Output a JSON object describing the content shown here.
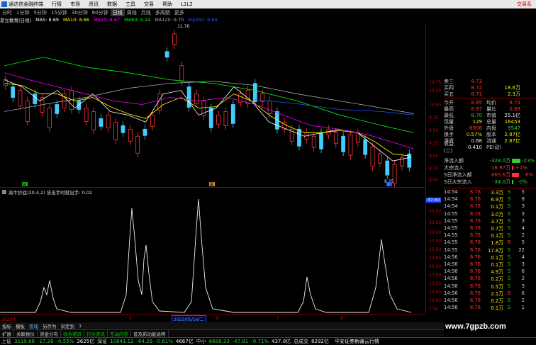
{
  "titlebar": {
    "app_name": "通达信金融终端",
    "menus": [
      "行情",
      "市场",
      "资讯",
      "数据",
      "工具",
      "交易",
      "帮助",
      "L1L2"
    ],
    "right_label": "交易系"
  },
  "toolbar": {
    "items": [
      "分时",
      "1分钟",
      "5分钟",
      "15分钟",
      "30分钟",
      "60分钟",
      "日线",
      "周线",
      "月线",
      "多周期",
      "更多"
    ],
    "active": "日线"
  },
  "ma_legend": {
    "stock": "昂立教育(日线)",
    "ma5": "MA5: 8.69",
    "ma10": "MA10: 8.66",
    "ma20": "MA20: 8.67",
    "ma60": "MA60: 9.24",
    "ma120": "MA120: 9.70",
    "ma250": "MA250: 9.89",
    "colors": {
      "ma5": "#ffffff",
      "ma10": "#ffff00",
      "ma20": "#ff00ff",
      "ma60": "#00ff00",
      "ma120": "#aaaaaa",
      "ma250": "#2255ff"
    }
  },
  "price_axis": [
    "11.25",
    "11.00",
    "10.75",
    "10.50",
    "10.25",
    "10.00",
    "9.75",
    "9.50",
    "9.25",
    "9.00",
    "8.75",
    "8.50",
    "8.25"
  ],
  "annotations": {
    "high": "11.76",
    "low": "8.25",
    "marker_left": "减",
    "marker_mid": "赢",
    "marker_low": "I"
  },
  "indicator": {
    "legend": "高牛抄底(20,4,2)  该出手时就出手: 0.02",
    "axis": [
      "37.50",
      "35.00",
      "32.50",
      "30.00",
      "27.50",
      "25.00",
      "22.50",
      "20.00",
      "17.50",
      "15.00",
      "12.50",
      "10.00",
      "7.50",
      "5.00",
      "2.50"
    ]
  },
  "dates": {
    "year": "2023年",
    "cursor_date": "2023/05/16/二",
    "months": [
      "5",
      "6",
      "7",
      "8"
    ]
  },
  "tabbar": [
    "指标",
    "模板",
    "管理",
    "另存为",
    "训定到",
    "1"
  ],
  "tabbar2": [
    "扩展",
    "关联报价",
    "资金分布",
    "综合资讯",
    "行业资讯",
    "互动问答",
    "普及新功能说明"
  ],
  "quote": {
    "asks": [
      {
        "label": "卖三",
        "price": "8.73",
        "vol": ""
      },
      {
        "label": "买四",
        "price": "8.72",
        "vol": "18.6万"
      },
      {
        "label": "买五",
        "price": "8.71",
        "vol": "2.3万"
      }
    ],
    "rows": [
      {
        "l1": "今开",
        "v1": "8.85",
        "l2": "均价",
        "v2": "8.73"
      },
      {
        "l1": "最高",
        "v1": "8.87",
        "l2": "量比",
        "v2": "0.69"
      },
      {
        "l1": "最低",
        "v1": "8.70",
        "l2": "市值",
        "v2": "25.1亿"
      },
      {
        "l1": "现量",
        "v1": "129",
        "l2": "总量",
        "v2": "16453"
      },
      {
        "l1": "外盘",
        "v1": "6906",
        "l2": "内盘",
        "v2": "9547"
      },
      {
        "l1": "换手",
        "v1": "0.57%",
        "l2": "股本",
        "v2": "2.87亿"
      },
      {
        "l1": "净资",
        "v1": "0.68",
        "l2": "流通",
        "v2": "2.87亿"
      },
      {
        "l1": "收益(二)",
        "v1": "-0.410",
        "l2": "PE(动)",
        "v2": ""
      }
    ]
  },
  "flow": [
    {
      "label": "净流入额",
      "value": "-328.0万",
      "pct": "-23%",
      "color": "#3c3"
    },
    {
      "label": "大宗流入",
      "value": "16.97万",
      "pct": "+1%",
      "color": "#f33"
    },
    {
      "label": "5日净流入额",
      "value": "665.6万",
      "pct": "6%",
      "color": "#f33"
    },
    {
      "label": "5日大宗流入",
      "value": "-34.0万",
      "pct": "-0%",
      "color": "#3c3"
    }
  ],
  "ticks": [
    {
      "t": "14:54",
      "p": "8.76",
      "v": "3.3万",
      "s": "S",
      "n": "5"
    },
    {
      "t": "14:54",
      "p": "8.76",
      "v": "6.9万",
      "s": "S",
      "n": "8"
    },
    {
      "t": "14:54",
      "p": "8.76",
      "v": "0.1万",
      "s": "S",
      "n": "3"
    },
    {
      "t": "14:55",
      "p": "8.76",
      "v": "3.0万",
      "s": "S",
      "n": "3"
    },
    {
      "t": "14:55",
      "p": "8.76",
      "v": "3.7万",
      "s": "S",
      "n": "3"
    },
    {
      "t": "14:55",
      "p": "8.76",
      "v": "0.7万",
      "s": "S",
      "n": "4"
    },
    {
      "t": "14:55",
      "p": "8.76",
      "v": "0.1万",
      "s": "S",
      "n": "2"
    },
    {
      "t": "14:55",
      "p": "8.76",
      "v": "1.8万",
      "s": "B",
      "n": "5"
    },
    {
      "t": "14:55",
      "p": "8.76",
      "v": "17.8万",
      "s": "S",
      "n": "22"
    },
    {
      "t": "14:56",
      "p": "8.76",
      "v": "0.1万",
      "s": "S",
      "n": "4"
    },
    {
      "t": "14:56",
      "p": "8.76",
      "v": "0.1万",
      "s": "S",
      "n": "3"
    },
    {
      "t": "14:56",
      "p": "8.76",
      "v": "4.9万",
      "s": "S",
      "n": "6"
    },
    {
      "t": "14:56",
      "p": "8.76",
      "v": "0.2万",
      "s": "S",
      "n": "2"
    },
    {
      "t": "14:56",
      "p": "8.76",
      "v": "0.5万",
      "s": "S",
      "n": "3"
    },
    {
      "t": "14:56",
      "p": "8.76",
      "v": "2.1万",
      "s": "B",
      "n": "6"
    },
    {
      "t": "14:56",
      "p": "8.76",
      "v": "0.2万",
      "s": "S",
      "n": "2"
    },
    {
      "t": "14:56",
      "p": "8.76",
      "v": "0.1万",
      "s": "S",
      "n": "1"
    }
  ],
  "statusbar": {
    "sh_name": "上证",
    "sh_val": "3119.88",
    "sh_chg": "-17.26",
    "sh_pct": "-0.55%",
    "sh_amt": "3625亿",
    "sz_name": "深证",
    "sz_val": "10841.12",
    "sz_chg": "-64.29",
    "sz_pct": "-0.61%",
    "sz_amt": "4667亿",
    "zx_name": "中小",
    "zx_val": "6689.33",
    "zx_chg": "-47.81",
    "zx_pct": "-0.71%",
    "zx_amt": "437.0亿",
    "total_name": "总成交",
    "total_val": "8292亿",
    "right": "平安证券新疆云行情"
  },
  "watermark": "www.7gpzb.com"
}
